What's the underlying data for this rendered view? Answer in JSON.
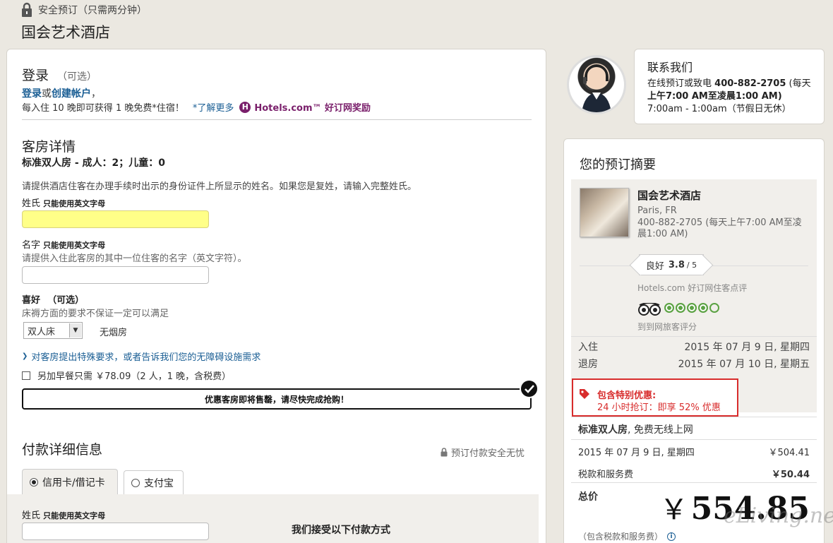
{
  "header": {
    "secure_text": "安全预订（只需两分钟）",
    "hotel_name": "国会艺术酒店"
  },
  "login": {
    "title": "登录",
    "optional": "（可选）",
    "login_link": "登录",
    "or": "或",
    "create_link": "创建帐户",
    "comma": "，",
    "reward_text": "每入住 10 晚即可获得 1 晚免费*住宿！",
    "learn_more": "*了解更多",
    "brand": "Hotels.com™ 好订网奖励"
  },
  "room": {
    "title": "客房详情",
    "subtitle": "标准双人房 - 成人：2；儿童：0",
    "note": "请提供酒店住客在办理手续时出示的身份证件上所显示的姓名。如果您是复姓，请输入完整姓氏。",
    "surname_label": "姓氏",
    "surname_hint": "只能使用英文字母",
    "given_label": "名字",
    "given_hint": "只能使用英文字母",
    "given_note": "请提供入住此客房的其中一位住客的名字（英文字符）。",
    "pref_label": "喜好",
    "pref_optional": "（可选）",
    "pref_note": "床褥方面的要求不保证一定可以满足",
    "bed_selected": "双人床",
    "smoking": "无烟房",
    "special_link": "对客房提出特殊要求，或者告诉我们您的无障碍设施需求",
    "breakfast": "另加早餐只需 ￥78.09（2 人，1 晚，含税费）",
    "breakfast_price": "￥78.09",
    "banner": "优惠客房即将售罄，请尽快完成抢购！"
  },
  "payment": {
    "title": "付款详细信息",
    "secure": "预订付款安全无忧",
    "tab_card": "信用卡/借记卡",
    "tab_alipay": "支付宝",
    "surname_label": "姓氏",
    "surname_hint": "只能使用英文字母",
    "accept_text": "我们接受以下付款方式"
  },
  "contact": {
    "title": "联系我们",
    "line1_prefix": "在线预订或致电",
    "phone": "400-882-2705",
    "line1_suffix": "(每天",
    "line2": "上午7:00 AM至凌晨1:00 AM)",
    "line3": "7:00am - 1:00am（节假日无休）"
  },
  "summary": {
    "title": "您的预订摘要",
    "hotel_name": "国会艺术酒店",
    "city": "Paris, FR",
    "phone": "400-882-2705 (每天上午7:00 AM至凌晨1:00 AM)",
    "rating_label": "良好",
    "rating_value": "3.8",
    "rating_max": "/ 5",
    "rating_source": "Hotels.com 好订网住客点评",
    "ta_label": "到到网旅客评分",
    "ta_rating": 4,
    "checkin_label": "入住",
    "checkin_date": "2015 年 07 月 9 日, 星期四",
    "checkout_label": "退房",
    "checkout_date": "2015 年 07 月 10 日, 星期五",
    "deal_title": "包含特别优惠:",
    "deal_text": "24 小时抢订：即享 52% 优惠",
    "room_type": "标准双人房",
    "room_extra": ", 免费无线上网",
    "night_date": "2015 年 07 月 9 日, 星期四",
    "night_price": "￥504.41",
    "tax_label": "税款和服务费",
    "tax_price": "￥50.44",
    "total_label": "总价",
    "total_currency": "￥",
    "total_amount": "554.85",
    "total_note": "（包含税款和服务费）"
  },
  "watermark": "eLiving.net",
  "colors": {
    "link": "#1a5e94",
    "brand_purple": "#7a1f6b",
    "deal_red": "#d82c2c",
    "highlight_input": "#ffff88",
    "tripadvisor_green": "#5ba243"
  }
}
